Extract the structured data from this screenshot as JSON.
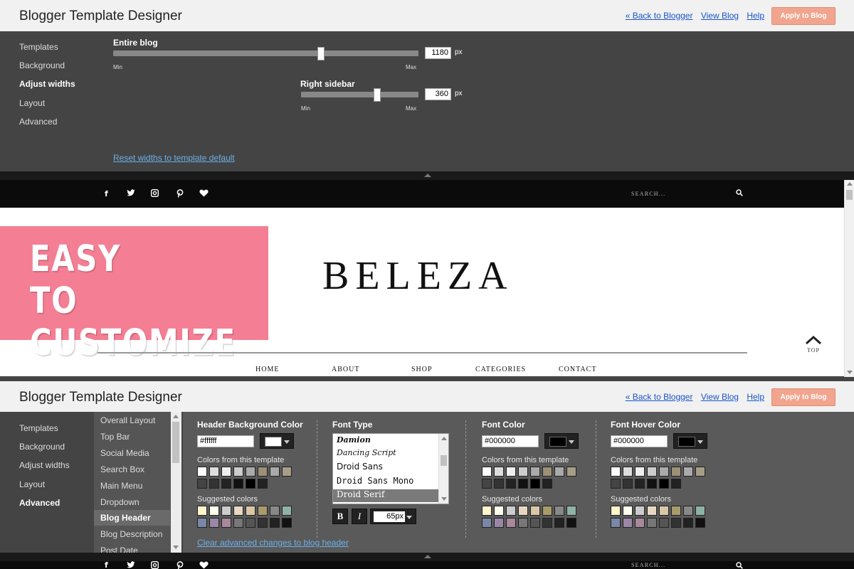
{
  "designer": {
    "title": "Blogger Template Designer",
    "back_link": "« Back to Blogger",
    "view_blog": "View Blog",
    "help": "Help",
    "apply": "Apply to Blog"
  },
  "nav": {
    "items": [
      "Templates",
      "Background",
      "Adjust widths",
      "Layout",
      "Advanced"
    ]
  },
  "widths": {
    "entire_blog_label": "Entire blog",
    "entire_blog_value": "1180",
    "entire_blog_fraction": 0.68,
    "right_sidebar_label": "Right sidebar",
    "right_sidebar_value": "360",
    "right_sidebar_fraction": 0.65,
    "min": "Min",
    "max": "Max",
    "unit": "px",
    "reset": "Reset widths to template default"
  },
  "preview": {
    "social_icons": [
      "facebook-icon",
      "twitter-icon",
      "instagram-icon",
      "pinterest-icon",
      "heart-icon"
    ],
    "search_placeholder": "SEARCH...",
    "banner_line1": "EASY",
    "banner_line2": "TO CUSTOMIZE",
    "banner_color": "#f47e93",
    "logo": "BELEZA",
    "menu": [
      "HOME",
      "ABOUT",
      "SHOP",
      "CATEGORIES",
      "CONTACT"
    ],
    "top_label": "TOP"
  },
  "advanced": {
    "subnav": [
      "Overall Layout",
      "Top Bar",
      "Social Media",
      "Search Box",
      "Main Menu",
      "Dropdown",
      "Blog Header",
      "Blog Description",
      "Post Date"
    ],
    "header_bg": {
      "title": "Header Background Color",
      "value": "#ffffff",
      "swatch": "#ffffff"
    },
    "font_type": {
      "title": "Font Type",
      "options": [
        "Damion",
        "Dancing Script",
        "Droid Sans",
        "Droid Sans Mono",
        "Droid Serif"
      ],
      "selected": "Droid Serif",
      "bold": "B",
      "italic": "I",
      "size": "65px"
    },
    "font_color": {
      "title": "Font Color",
      "value": "#000000",
      "swatch": "#000000"
    },
    "font_hover": {
      "title": "Font Hover Color",
      "value": "#000000",
      "swatch": "#000000"
    },
    "colors_from_template": "Colors from this template",
    "suggested_colors": "Suggested colors",
    "template_colors": [
      "#ffffff",
      "#dddddd",
      "#eeeeee",
      "#cccccc",
      "#aaaaaa",
      "#9c9077",
      "#aaaaaa",
      "#a79e88",
      "#444444",
      "#333333",
      "#222222",
      "#111111",
      "#000000",
      "#222222"
    ],
    "suggested_palette": [
      "#fff5cc",
      "#ffffee",
      "#cccccc",
      "#e6d8c0",
      "#d9c7a7",
      "#a89b6b",
      "#888888",
      "#8db3a6",
      "#7a88a8",
      "#9b86a8",
      "#a8889b",
      "#777777",
      "#555555",
      "#333333",
      "#222222",
      "#111111"
    ],
    "clear": "Clear advanced changes to blog header"
  }
}
